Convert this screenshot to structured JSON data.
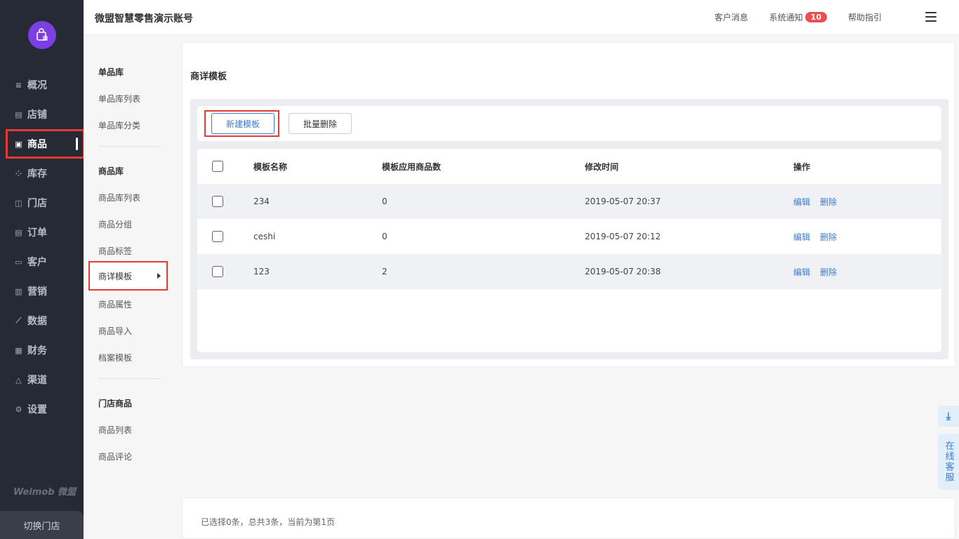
{
  "header": {
    "account": "微盟智慧零售演示账号",
    "links": [
      "客户消息",
      "系统通知",
      "帮助指引"
    ],
    "notify_badge": "10"
  },
  "sidebar": {
    "items": [
      {
        "label": "概况",
        "icon": "list-icon"
      },
      {
        "label": "店铺",
        "icon": "store-icon"
      },
      {
        "label": "商品",
        "icon": "goods-icon"
      },
      {
        "label": "库存",
        "icon": "inventory-icon"
      },
      {
        "label": "门店",
        "icon": "shop-icon"
      },
      {
        "label": "订单",
        "icon": "order-icon"
      },
      {
        "label": "客户",
        "icon": "vip-icon"
      },
      {
        "label": "营销",
        "icon": "bar-chart-icon"
      },
      {
        "label": "数据",
        "icon": "trend-icon"
      },
      {
        "label": "财务",
        "icon": "calculator-icon"
      },
      {
        "label": "渠道",
        "icon": "channel-icon"
      },
      {
        "label": "设置",
        "icon": "gear-icon"
      }
    ],
    "active": "商品",
    "brand": "Weimob 微盟",
    "switch_store": "切换门店"
  },
  "subnav": {
    "group1": "单品库",
    "group1_items": [
      "单品库列表",
      "单品库分类"
    ],
    "group2": "商品库",
    "group2_items": [
      "商品库列表",
      "商品分组",
      "商品标签",
      "商详模板",
      "商品属性",
      "商品导入",
      "档案模板"
    ],
    "group3": "门店商品",
    "group3_items": [
      "商品列表",
      "商品评论"
    ]
  },
  "main": {
    "title": "商详模板",
    "new_button": "新建模板",
    "batch_delete_button": "批量删除",
    "columns": [
      "模板名称",
      "模板应用商品数",
      "修改时间",
      "操作"
    ],
    "rows": [
      {
        "name": "234",
        "count": "0",
        "time": "2019-05-07 20:37"
      },
      {
        "name": "ceshi",
        "count": "0",
        "time": "2019-05-07 20:12"
      },
      {
        "name": "123",
        "count": "2",
        "time": "2019-05-07 20:38"
      }
    ],
    "edit_label": "编辑",
    "delete_label": "删除",
    "footer": "已选择0条，总共3条，当前为第1页"
  },
  "float": {
    "service": "在线客服"
  },
  "colors": {
    "accent": "#3a7bd5",
    "sidebar_bg": "#262a35",
    "highlight": "#e53935",
    "badge": "#ef4e4e"
  }
}
